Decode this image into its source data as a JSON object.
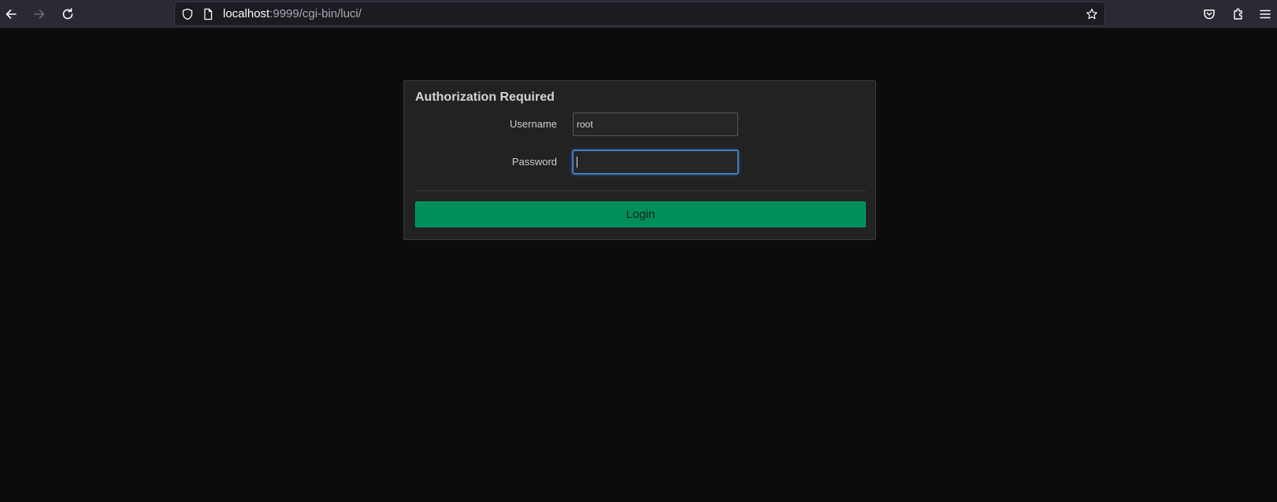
{
  "browser": {
    "url_host": "localhost",
    "url_rest": ":9999/cgi-bin/luci/",
    "icons": {
      "back": "arrow-left-icon",
      "forward": "arrow-right-icon",
      "reload": "reload-icon",
      "shield": "shield-icon",
      "page": "page-icon",
      "bookmark": "star-icon",
      "pocket": "pocket-icon",
      "extensions": "puzzle-icon",
      "menu": "hamburger-menu-icon"
    }
  },
  "login": {
    "title": "Authorization Required",
    "username_label": "Username",
    "username_value": "root",
    "password_label": "Password",
    "password_value": "",
    "login_button": "Login"
  },
  "colors": {
    "background": "#0c0c0c",
    "panel": "#222222",
    "button": "#008f5b",
    "focus": "#4d8fd6"
  }
}
